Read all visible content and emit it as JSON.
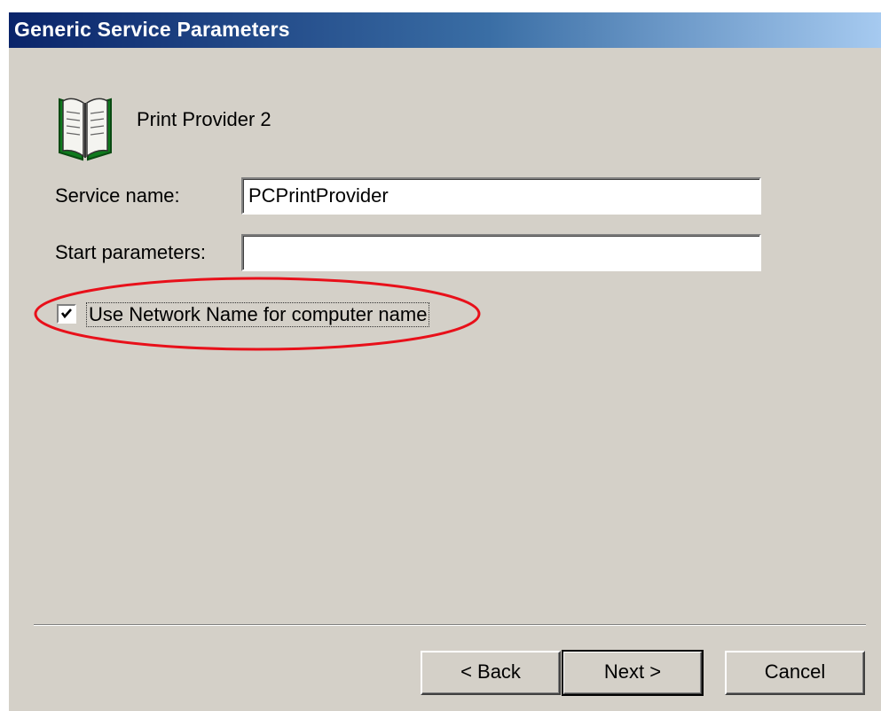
{
  "dialog": {
    "title": "Generic Service Parameters",
    "provider_name": "Print Provider 2",
    "provider_icon": "book-icon"
  },
  "form": {
    "service_name_label": "Service name:",
    "service_name_value": "PCPrintProvider",
    "start_parameters_label": "Start parameters:",
    "start_parameters_value": "",
    "use_network_name_label": "Use Network Name for computer name",
    "use_network_name_checked": true
  },
  "buttons": {
    "back_label": "< Back",
    "next_label": "Next >",
    "cancel_label": "Cancel"
  },
  "colors": {
    "title_gradient_start": "#0a246a",
    "title_gradient_end": "#a6caf0",
    "dialog_bg": "#d4d0c8",
    "annotation_ellipse": "#e8101a"
  }
}
